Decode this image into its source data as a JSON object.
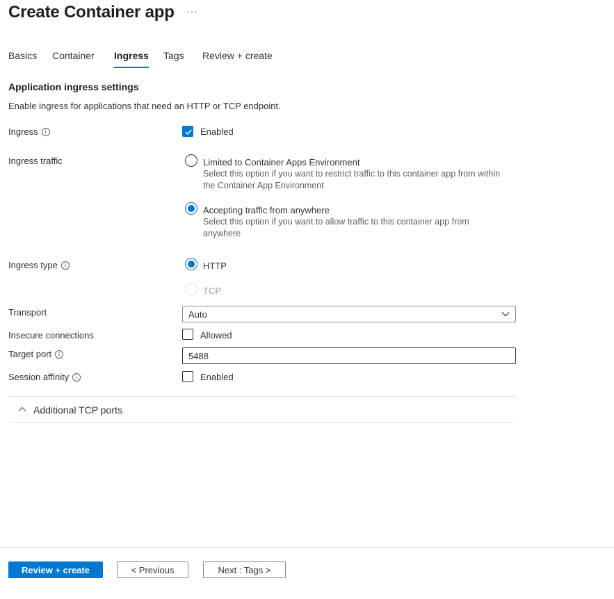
{
  "header": {
    "title": "Create Container app",
    "more": "···"
  },
  "tabs": [
    {
      "label": "Basics"
    },
    {
      "label": "Container"
    },
    {
      "label": "Ingress"
    },
    {
      "label": "Tags"
    },
    {
      "label": "Review + create"
    }
  ],
  "active_tab": "Ingress",
  "section": {
    "title": "Application ingress settings",
    "description": "Enable ingress for applications that need an HTTP or TCP endpoint."
  },
  "ingress": {
    "label": "Ingress",
    "checkbox_label": "Enabled",
    "checked": true
  },
  "ingress_traffic": {
    "label": "Ingress traffic",
    "options": [
      {
        "label": "Limited to Container Apps Environment",
        "description": "Select this option if you want to restrict traffic to this container app from within the Container App Environment",
        "selected": false
      },
      {
        "label": "Accepting traffic from anywhere",
        "description": "Select this option if you want to allow traffic to this container app from anywhere",
        "selected": true
      }
    ]
  },
  "ingress_type": {
    "label": "Ingress type",
    "options": [
      {
        "label": "HTTP",
        "selected": true,
        "disabled": false
      },
      {
        "label": "TCP",
        "selected": false,
        "disabled": true
      }
    ]
  },
  "transport": {
    "label": "Transport",
    "value": "Auto"
  },
  "insecure_connections": {
    "label": "Insecure connections",
    "checkbox_label": "Allowed",
    "checked": false
  },
  "target_port": {
    "label": "Target port",
    "value": "5488"
  },
  "session_affinity": {
    "label": "Session affinity",
    "checkbox_label": "Enabled",
    "checked": false
  },
  "additional_ports": {
    "label": "Additional TCP ports",
    "expanded": false
  },
  "footer": {
    "review_create": "Review + create",
    "previous": "< Previous",
    "next": "Next : Tags >"
  },
  "colors": {
    "accent": "#0078d4",
    "text": "#323130",
    "border": "#8a8886",
    "divider": "#e1dfdd"
  },
  "icons": [
    "info-icon",
    "checkmark-icon",
    "chevron-down-icon",
    "chevron-up-icon",
    "more-icon"
  ]
}
